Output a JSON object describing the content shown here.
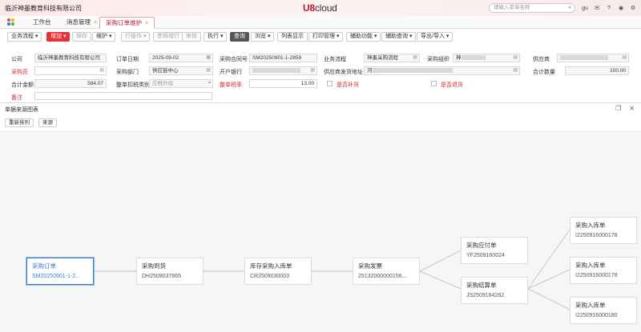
{
  "header": {
    "company": "临沂神墨教育科技有限公司",
    "logo_brand": "U8",
    "logo_cloud": "cloud",
    "search_placeholder": "请输入菜单名称",
    "user_label": "gu"
  },
  "tabs": [
    {
      "label": "工作台"
    },
    {
      "label": "消息管理"
    },
    {
      "label": "采购订单维护"
    }
  ],
  "toolbar": [
    {
      "label": "业务流程 ▾"
    },
    {
      "label": "增加 ▾"
    },
    {
      "label": "保存"
    },
    {
      "label": "维护 ▾"
    },
    {
      "label": "行操作 ▾"
    },
    {
      "label": "参照增行"
    },
    {
      "label": "审核"
    },
    {
      "label": "执行 ▾"
    },
    {
      "label": "查询"
    },
    {
      "label": "浏览 ▾"
    },
    {
      "label": "列表显示"
    },
    {
      "label": "打印管理 ▾"
    },
    {
      "label": "辅助功能 ▾"
    },
    {
      "label": "辅助查询 ▾"
    },
    {
      "label": "导出/导入 ▾"
    }
  ],
  "form": {
    "company_label": "公司",
    "company_value": "临沂神墨教育科技有限公司",
    "order_date_label": "订单日期",
    "order_date_value": "2025-09-02",
    "contract_label": "采购合同号",
    "contract_value": "SM20250901-1-2859",
    "flow_label": "业务流程",
    "flow_value": "神墨采购流程",
    "org_label": "采购组织",
    "org_value": "神",
    "supplier_label": "供应商",
    "buyer_label": "采购员",
    "dept_label": "采购部门",
    "dept_value": "供应链中心",
    "bank_label": "开户银行",
    "address_label": "供应商发货地址",
    "address_value": "河",
    "qty_label": "合计数量",
    "qty_value": "100.00",
    "amount_label": "合计金额",
    "amount_value": "584.07",
    "discount_label": "整单扣税类别",
    "discount_value": "应税外加",
    "tax_label": "整单税率",
    "tax_value": "13.00",
    "supplement_label": "是否补货",
    "return_label": "是否退货",
    "remark_label": "备注"
  },
  "panel": {
    "title": "单据来源图表",
    "rearrange": "重新排列",
    "source": "来源"
  },
  "graph": [
    {
      "title": "采购订单",
      "code": "SM20250901-1-2..."
    },
    {
      "title": "采购到货",
      "code": "DH2509037865"
    },
    {
      "title": "库存采购入库单",
      "code": "CR2509030003"
    },
    {
      "title": "采购发票",
      "code": "25132000000156..."
    },
    {
      "title": "采购应付单",
      "code": "YF2509160024"
    },
    {
      "title": "采购结算单",
      "code": "JS2509164282"
    },
    {
      "title": "采购入库单",
      "code": "I2250916000178"
    },
    {
      "title": "采购入库单",
      "code": "I2250916000179"
    },
    {
      "title": "采购入库单",
      "code": "I2250916000180"
    }
  ],
  "colors": {
    "accent": "#e63232",
    "selected": "#3a7bd5"
  }
}
